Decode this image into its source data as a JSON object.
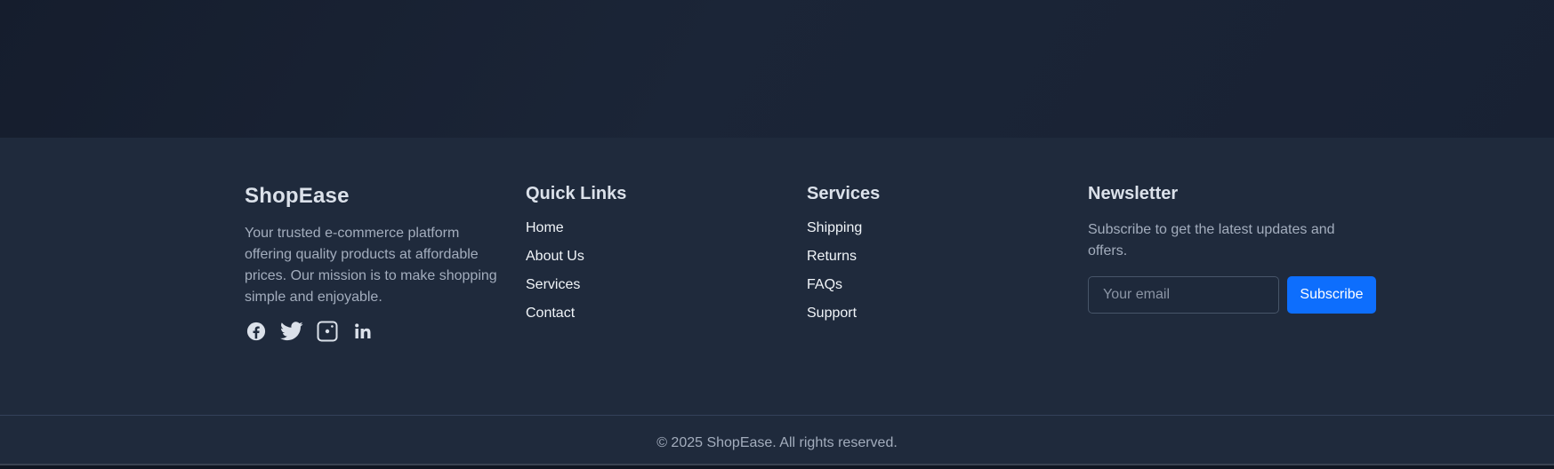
{
  "brand": {
    "name": "ShopEase",
    "description": "Your trusted e-commerce platform offering quality products at affordable prices. Our mission is to make shopping simple and enjoyable.",
    "socials": [
      {
        "name": "facebook-icon"
      },
      {
        "name": "twitter-icon"
      },
      {
        "name": "instagram-icon"
      },
      {
        "name": "linkedin-icon"
      }
    ]
  },
  "quick_links": {
    "heading": "Quick Links",
    "items": [
      "Home",
      "About Us",
      "Services",
      "Contact"
    ]
  },
  "services": {
    "heading": "Services",
    "items": [
      "Shipping",
      "Returns",
      "FAQs",
      "Support"
    ]
  },
  "newsletter": {
    "heading": "Newsletter",
    "description": "Subscribe to get the latest updates and offers.",
    "email_placeholder": "Your email",
    "email_value": "",
    "button_label": "Subscribe"
  },
  "copyright": "© 2025 ShopEase. All rights reserved.",
  "colors": {
    "background": "#1e293b",
    "accent": "#0d6efd",
    "heading": "#dbe1ea",
    "muted_text": "#a3adbd"
  }
}
